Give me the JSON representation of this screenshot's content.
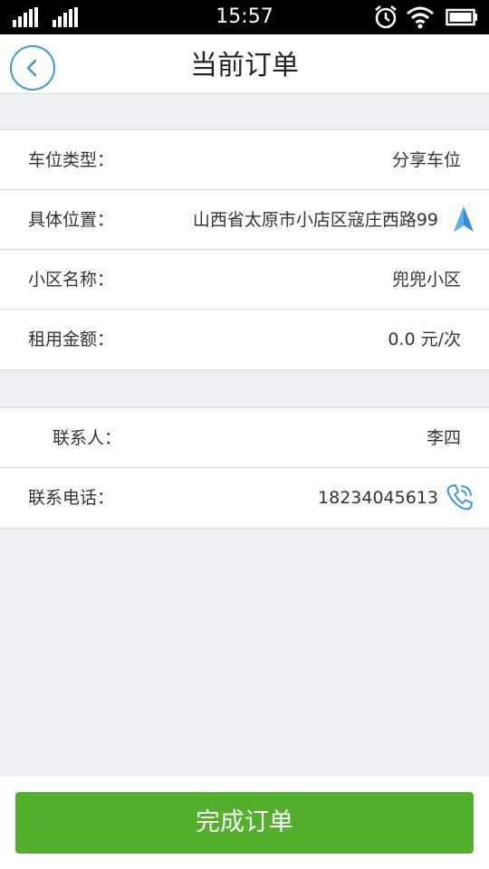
{
  "status_bar": {
    "time": "15:57"
  },
  "header": {
    "title": "当前订单"
  },
  "order_info": [
    {
      "label": "车位类型：",
      "value": "分享车位"
    },
    {
      "label": "具体位置：",
      "value": "山西省太原市小店区寇庄西路99"
    },
    {
      "label": "小区名称：",
      "value": "兜兜小区"
    },
    {
      "label": "租用金额：",
      "value": "0.0 元/次"
    }
  ],
  "contact_info": [
    {
      "label": "联系人：",
      "value": "李四"
    },
    {
      "label": "联系电话：",
      "value": "18234045613"
    }
  ],
  "footer": {
    "complete_button": "完成订单"
  },
  "colors": {
    "accent": "#3a9ad9",
    "primary_button": "#52b02c",
    "page_bg": "#eef0f3"
  },
  "icons": {
    "back": "chevron-left-icon",
    "location": "navigation-arrow-icon",
    "phone": "phone-call-icon"
  }
}
